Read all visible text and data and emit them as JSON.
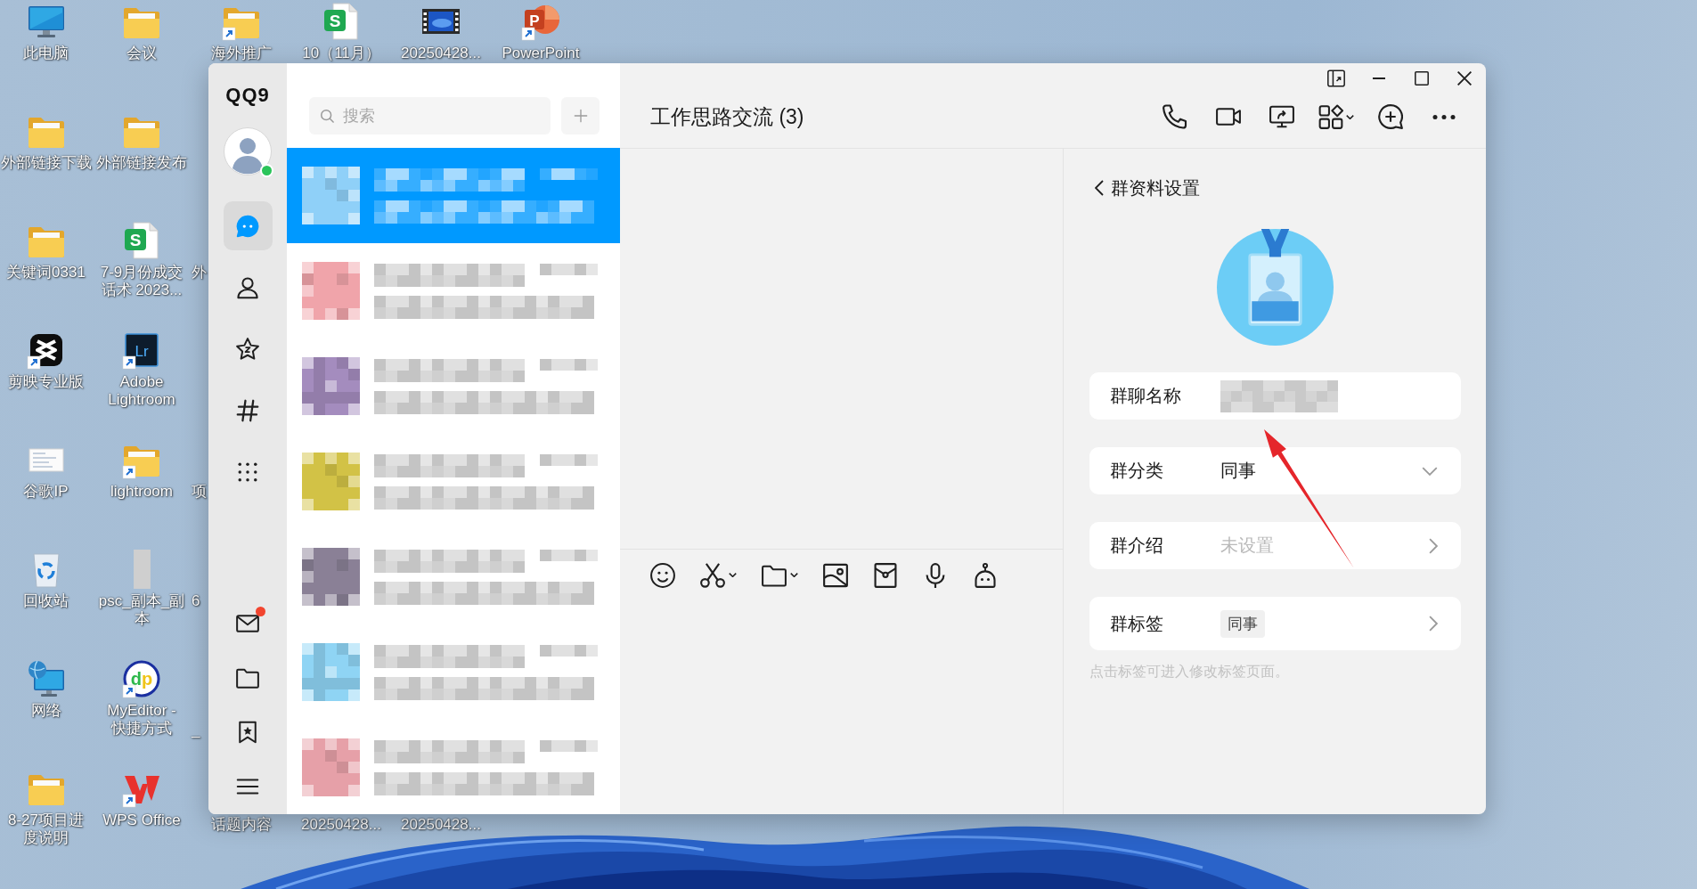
{
  "desktop": {
    "column_1": [
      {
        "lines": [
          "此电脑"
        ],
        "kind": "computer",
        "shortcut": false
      },
      {
        "lines": [
          "外部链接下载"
        ],
        "kind": "folder",
        "shortcut": false
      },
      {
        "lines": [
          "关键词0331"
        ],
        "kind": "folder",
        "shortcut": false
      },
      {
        "lines": [
          "剪映专业版"
        ],
        "kind": "cutter",
        "shortcut": true
      },
      {
        "lines": [
          "谷歌IP"
        ],
        "kind": "document",
        "shortcut": false
      },
      {
        "lines": [
          "回收站"
        ],
        "kind": "recycle",
        "shortcut": false
      },
      {
        "lines": [
          "网络"
        ],
        "kind": "network",
        "shortcut": false
      },
      {
        "lines": [
          "8-27项目进",
          "度说明"
        ],
        "kind": "folder",
        "shortcut": false
      }
    ],
    "column_2": [
      {
        "lines": [
          "会议"
        ],
        "kind": "folder",
        "shortcut": false
      },
      {
        "lines": [
          "外部链接发布"
        ],
        "kind": "folder",
        "shortcut": false
      },
      {
        "lines": [
          "7-9月份成交",
          "话术 2023..."
        ],
        "kind": "spreadsheet",
        "logo_text": "S",
        "shortcut": false
      },
      {
        "lines": [
          "Adobe",
          "Lightroom"
        ],
        "kind": "tile",
        "logo_text": "Lr",
        "shortcut": true
      },
      {
        "lines": [
          "lightroom"
        ],
        "kind": "folder",
        "shortcut": true
      },
      {
        "lines": [
          "psc_副本_副",
          "本"
        ],
        "kind": "photo",
        "shortcut": false
      },
      {
        "lines": [
          "MyEditor -",
          "快捷方式"
        ],
        "kind": "badge",
        "logo_text": "dp",
        "shortcut": true
      },
      {
        "lines": [
          "WPS Office"
        ],
        "kind": "wps",
        "shortcut": true
      }
    ],
    "top_row": [
      {
        "lines": [
          "海外推广"
        ],
        "kind": "folder",
        "shortcut": true
      },
      {
        "lines": [
          "10（11月）"
        ],
        "kind": "spreadsheet",
        "logo_text": "S",
        "shortcut": false
      },
      {
        "lines": [
          "20250428..."
        ],
        "kind": "video",
        "shortcut": false
      },
      {
        "lines": [
          "PowerPoint"
        ],
        "kind": "slides",
        "logo_text": "P",
        "shortcut": true
      }
    ],
    "edge_fragments": [
      "外",
      "项",
      "6",
      "_"
    ],
    "bottom_row": [
      "话题内容",
      "20250428...",
      "20250428..."
    ]
  },
  "qq": {
    "sidebar": {
      "logo": "QQ9",
      "avatar": {
        "online": true
      },
      "nav": [
        {
          "kind": "chats",
          "selected": true
        },
        {
          "kind": "contacts",
          "selected": false
        },
        {
          "kind": "space",
          "selected": false
        },
        {
          "kind": "channels",
          "selected": false
        },
        {
          "kind": "apps",
          "selected": false
        }
      ],
      "bottom_nav": [
        {
          "kind": "mail",
          "unread": true
        },
        {
          "kind": "files",
          "unread": false
        },
        {
          "kind": "favorites",
          "unread": false
        },
        {
          "kind": "menu",
          "unread": false
        }
      ]
    },
    "chat_list": {
      "search": {
        "placeholder": "搜索"
      },
      "items": [
        {
          "selected": true,
          "color": "#8fd0f8"
        },
        {
          "selected": false,
          "color": "#f0a4aa"
        },
        {
          "selected": false,
          "color": "#a48cbe"
        },
        {
          "selected": false,
          "color": "#d2c246"
        },
        {
          "selected": false,
          "color": "#8a8096"
        },
        {
          "selected": false,
          "color": "#8fd4f4"
        },
        {
          "selected": false,
          "color": "#e6a0a8"
        }
      ]
    },
    "chat": {
      "title": "工作思路交流 (3)"
    },
    "group_settings": {
      "title": "群资料设置",
      "fields": [
        {
          "kind": "redacted",
          "label": "群聊名称",
          "unset": false
        },
        {
          "kind": "dropdown",
          "label": "群分类",
          "value": "同事",
          "unset": false
        },
        {
          "kind": "link",
          "label": "群介绍",
          "value": "未设置",
          "unset": true
        },
        {
          "kind": "tags",
          "label": "群标签",
          "tags": [
            "同事"
          ],
          "unset": false
        }
      ],
      "hint": "点击标签可进入修改标签页面。"
    }
  }
}
